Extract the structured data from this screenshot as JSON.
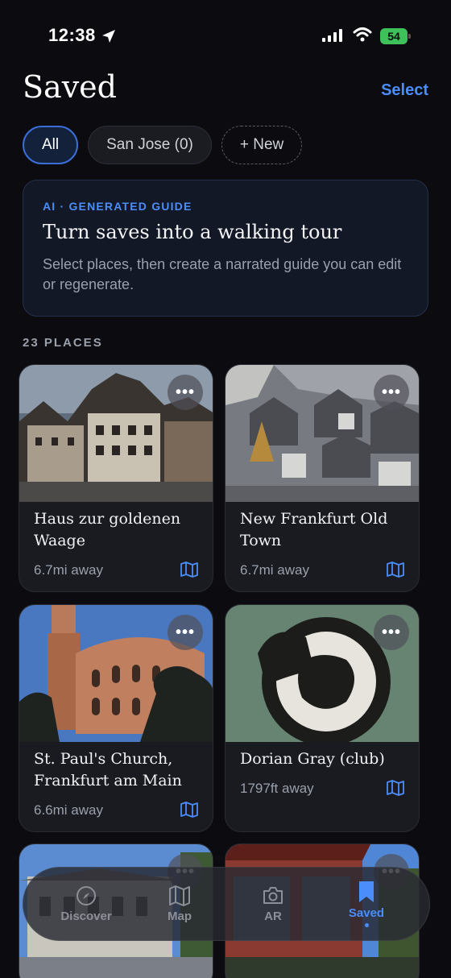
{
  "status_bar": {
    "time": "12:38",
    "battery": "54"
  },
  "header": {
    "title": "Saved",
    "select_label": "Select"
  },
  "chips": [
    {
      "label": "All",
      "active": true
    },
    {
      "label": "San Jose (0)",
      "active": false
    },
    {
      "label": "+ New",
      "active": false
    }
  ],
  "ai_card": {
    "eyebrow": "AI · GENERATED GUIDE",
    "title": "Turn saves into a walking tour",
    "description": "Select places, then create a narrated guide you can edit or regenerate."
  },
  "places_count_label": "23 PLACES",
  "places": [
    {
      "name": "Haus zur goldenen Waage",
      "distance": "6.7mi away"
    },
    {
      "name": "New Frankfurt Old Town",
      "distance": "6.7mi away"
    },
    {
      "name": "St. Paul's Church, Frankfurt am Main",
      "distance": "6.6mi away"
    },
    {
      "name": "Dorian Gray (club)",
      "distance": "1797ft away"
    }
  ],
  "more_label": "•••",
  "tabs": [
    {
      "label": "Discover",
      "icon": "compass-icon"
    },
    {
      "label": "Map",
      "icon": "map-icon"
    },
    {
      "label": "AR",
      "icon": "camera-icon"
    },
    {
      "label": "Saved",
      "icon": "bookmark-icon",
      "active": true
    }
  ],
  "colors": {
    "accent": "#4a8dfb",
    "background": "#0c0c10",
    "battery": "#3ec15b"
  }
}
